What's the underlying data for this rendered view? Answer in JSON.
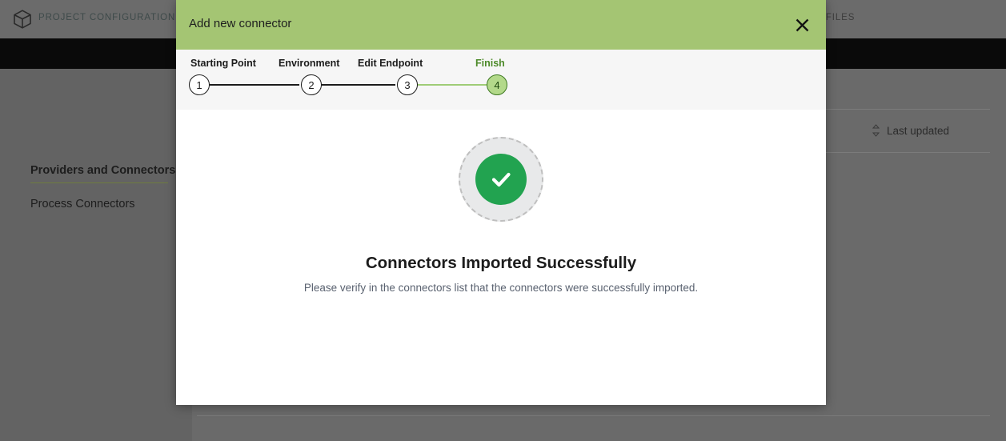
{
  "background": {
    "logo_icon": "cube-icon",
    "project_title": "PROJECT CONFIGURATION",
    "add_icon": "plus-icon",
    "nav": [
      {
        "label": "Providers and Connectors",
        "active": true
      },
      {
        "label": "Process Connectors",
        "active": false
      }
    ],
    "section_title": "ED FILES",
    "sort": {
      "icon": "sort-updown-icon",
      "label": "Last updated"
    }
  },
  "tooltip": {
    "name": "tooltip-bubble",
    "color": "#555550"
  },
  "modal": {
    "title": "Add new connector",
    "close_icon": "close-icon",
    "header_color": "#a4c573",
    "stepper": {
      "steps": [
        {
          "number": "1",
          "label": "Starting Point",
          "state": "done"
        },
        {
          "number": "2",
          "label": "Environment",
          "state": "done"
        },
        {
          "number": "3",
          "label": "Edit Endpoint",
          "state": "done"
        },
        {
          "number": "4",
          "label": "Finish",
          "state": "current"
        }
      ]
    },
    "result": {
      "icon": "check-circle-icon",
      "icon_color": "#22a350",
      "title": "Connectors Imported Successfully",
      "subtitle": "Please verify in the connectors list that the connectors were successfully imported."
    }
  }
}
